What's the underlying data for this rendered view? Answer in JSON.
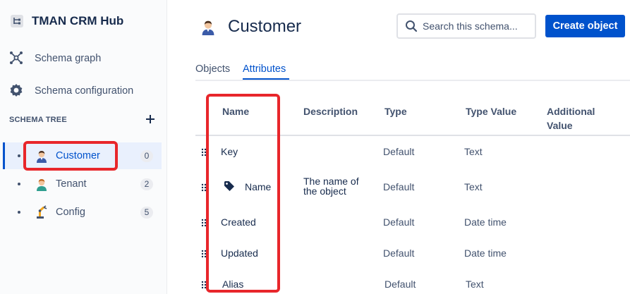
{
  "app": {
    "title": "TMAN CRM Hub"
  },
  "nav": {
    "schema_graph": "Schema graph",
    "schema_configuration": "Schema configuration"
  },
  "tree": {
    "heading": "SCHEMA TREE",
    "items": [
      {
        "label": "Customer",
        "count": "0",
        "icon": "customer-avatar-icon",
        "selected": true
      },
      {
        "label": "Tenant",
        "count": "2",
        "icon": "tenant-avatar-icon",
        "selected": false
      },
      {
        "label": "Config",
        "count": "5",
        "icon": "robot-arm-icon",
        "selected": false
      }
    ]
  },
  "page": {
    "title": "Customer",
    "search_placeholder": "Search this schema...",
    "create_button": "Create object"
  },
  "tabs": [
    {
      "label": "Objects",
      "active": false
    },
    {
      "label": "Attributes",
      "active": true
    }
  ],
  "table": {
    "headers": {
      "name": "Name",
      "description": "Description",
      "type": "Type",
      "type_value": "Type Value",
      "additional_value_1": "Additional",
      "additional_value_2": "Value"
    },
    "rows": [
      {
        "name": "Key",
        "description": "",
        "type": "Default",
        "type_value": "Text"
      },
      {
        "name": "Name",
        "description_1": "The name of",
        "description_2": "the object",
        "type": "Default",
        "type_value": "Text",
        "has_tag_icon": true
      },
      {
        "name": "Created",
        "description": "",
        "type": "Default",
        "type_value": "Date time"
      },
      {
        "name": "Updated",
        "description": "",
        "type": "Default",
        "type_value": "Date time"
      },
      {
        "name": "Alias",
        "description": "",
        "type": "Default",
        "type_value": "Text"
      }
    ]
  },
  "colors": {
    "accent": "#0052cc",
    "highlight": "#e8262b",
    "sidebar_bg": "#fafbfc",
    "selected_bg": "#e9f0fd"
  }
}
